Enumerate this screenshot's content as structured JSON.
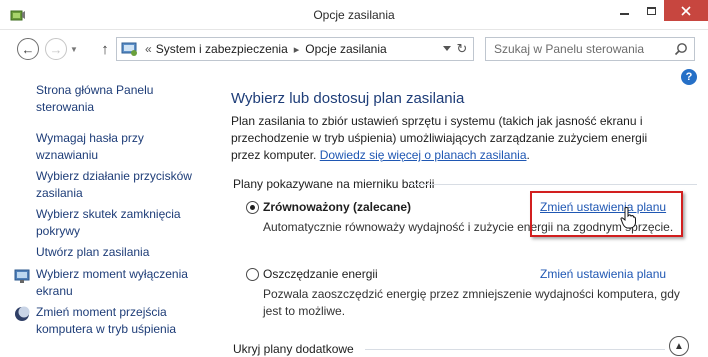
{
  "window": {
    "title": "Opcje zasilania"
  },
  "address": {
    "breadcrumbs": [
      "System i zabezpieczenia",
      "Opcje zasilania"
    ],
    "chevron": "«"
  },
  "search": {
    "placeholder": "Szukaj w Panelu sterowania"
  },
  "sidebar": {
    "home_link": "Strona główna Panelu sterowania",
    "items": [
      {
        "label": "Wymagaj hasła przy wznawianiu",
        "icon": "none"
      },
      {
        "label": "Wybierz działanie przycisków zasilania",
        "icon": "none"
      },
      {
        "label": "Wybierz skutek zamknięcia pokrywy",
        "icon": "none"
      },
      {
        "label": "Utwórz plan zasilania",
        "icon": "none"
      },
      {
        "label": "Wybierz moment wyłączenia ekranu",
        "icon": "monitor-icon"
      },
      {
        "label": "Zmień moment przejścia komputera w tryb uśpienia",
        "icon": "moon-icon"
      }
    ]
  },
  "main": {
    "title": "Wybierz lub dostosuj plan zasilania",
    "intro_text": "Plan zasilania to zbiór ustawień sprzętu i systemu (takich jak jasność ekranu i przechodzenie w tryb uśpienia) umożliwiających zarządzanie zużyciem energii przez komputer. ",
    "intro_link": "Dowiedz się więcej o planach zasilania",
    "intro_end": ".",
    "section_title": "Plany pokazywane na mierniku baterii",
    "plans": [
      {
        "name": "Zrównoważony (zalecane)",
        "selected": true,
        "description": "Automatycznie równoważy wydajność i zużycie energii na zgodnym sprzęcie.",
        "link": "Zmień ustawienia planu"
      },
      {
        "name": "Oszczędzanie energii",
        "selected": false,
        "description": "Pozwala zaoszczędzić energię przez zmniejszenie wydajności komputera, gdy jest to możliwe.",
        "link": "Zmień ustawienia planu"
      }
    ],
    "hidden_plans_label": "Ukryj plany dodatkowe",
    "help": "?"
  },
  "colors": {
    "link": "#1f57b3",
    "title": "#1e3d78",
    "highlight": "#d21f1f",
    "close_button": "#c7463f"
  }
}
